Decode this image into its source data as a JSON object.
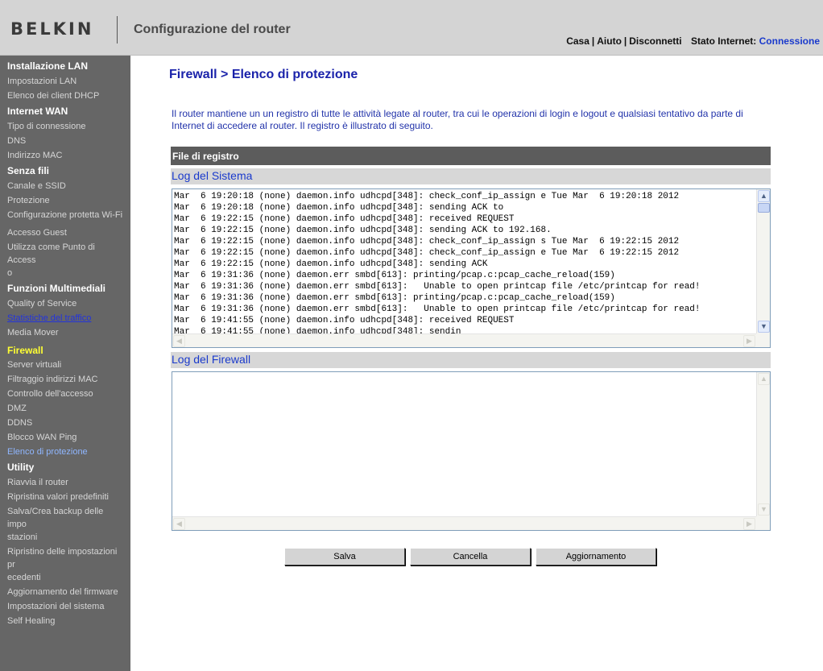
{
  "header": {
    "logo": "BELKIN",
    "title": "Configurazione del router",
    "links": [
      "Casa",
      "Aiuto",
      "Disconnetti"
    ],
    "status_label": "Stato Internet:",
    "status_value": "Connessione"
  },
  "sidebar": {
    "sections": [
      {
        "title": "Installazione LAN",
        "items": [
          "Impostazioni LAN",
          "Elenco dei client DHCP"
        ]
      },
      {
        "title": "Internet WAN",
        "items": [
          "Tipo di connessione",
          "DNS",
          "Indirizzo MAC"
        ]
      },
      {
        "title": "Senza fili",
        "items": [
          "Canale e SSID",
          "Protezione",
          "Configurazione protetta Wi-Fi",
          "Accesso Guest",
          "Utilizza come Punto di Access",
          "o"
        ]
      },
      {
        "title": "Funzioni Multimediali",
        "items": [
          "Quality of Service",
          "Statistiche del traffico",
          "Media Mover"
        ]
      },
      {
        "title": "Firewall",
        "items": [
          "Server virtuali",
          "Filtraggio indirizzi MAC",
          "Controllo dell'accesso",
          "DMZ",
          "DDNS",
          "Blocco WAN Ping",
          "Elenco di protezione"
        ]
      },
      {
        "title": "Utility",
        "items": [
          "Riavvia il router",
          "Ripristina valori predefiniti",
          "Salva/Crea backup delle impo",
          "stazioni",
          "Ripristino delle impostazioni pr",
          "ecedenti",
          "Aggiornamento del firmware",
          "Impostazioni del sistema",
          "Self Healing"
        ]
      }
    ]
  },
  "main": {
    "page_title": "Firewall > Elenco di protezione",
    "description": "Il router mantiene un un registro di tutte le attività legate al router, tra cui le operazioni di login e logout e qualsiasi tentativo da parte di Internet di accedere al router. Il registro è illustrato di seguito.",
    "file_bar": "File di registro",
    "system_log_title": "Log del Sistema",
    "system_log": "Mar  6 19:20:18 (none) daemon.info udhcpd[348]: check_conf_ip_assign e Tue Mar  6 19:20:18 2012\nMar  6 19:20:18 (none) daemon.info udhcpd[348]: sending ACK to\nMar  6 19:22:15 (none) daemon.info udhcpd[348]: received REQUEST\nMar  6 19:22:15 (none) daemon.info udhcpd[348]: sending ACK to 192.168.\nMar  6 19:22:15 (none) daemon.info udhcpd[348]: check_conf_ip_assign s Tue Mar  6 19:22:15 2012\nMar  6 19:22:15 (none) daemon.info udhcpd[348]: check_conf_ip_assign e Tue Mar  6 19:22:15 2012\nMar  6 19:22:15 (none) daemon.info udhcpd[348]: sending ACK\nMar  6 19:31:36 (none) daemon.err smbd[613]: printing/pcap.c:pcap_cache_reload(159)\nMar  6 19:31:36 (none) daemon.err smbd[613]:   Unable to open printcap file /etc/printcap for read!\nMar  6 19:31:36 (none) daemon.err smbd[613]: printing/pcap.c:pcap_cache_reload(159)\nMar  6 19:31:36 (none) daemon.err smbd[613]:   Unable to open printcap file /etc/printcap for read!\nMar  6 19:41:55 (none) daemon.info udhcpd[348]: received REQUEST\nMar  6 19:41:55 (none) daemon.info udhcpd[348]: sendin",
    "firewall_log_title": "Log del Firewall",
    "firewall_log": "",
    "buttons": {
      "save": "Salva",
      "clear": "Cancella",
      "refresh": "Aggiornamento"
    }
  }
}
